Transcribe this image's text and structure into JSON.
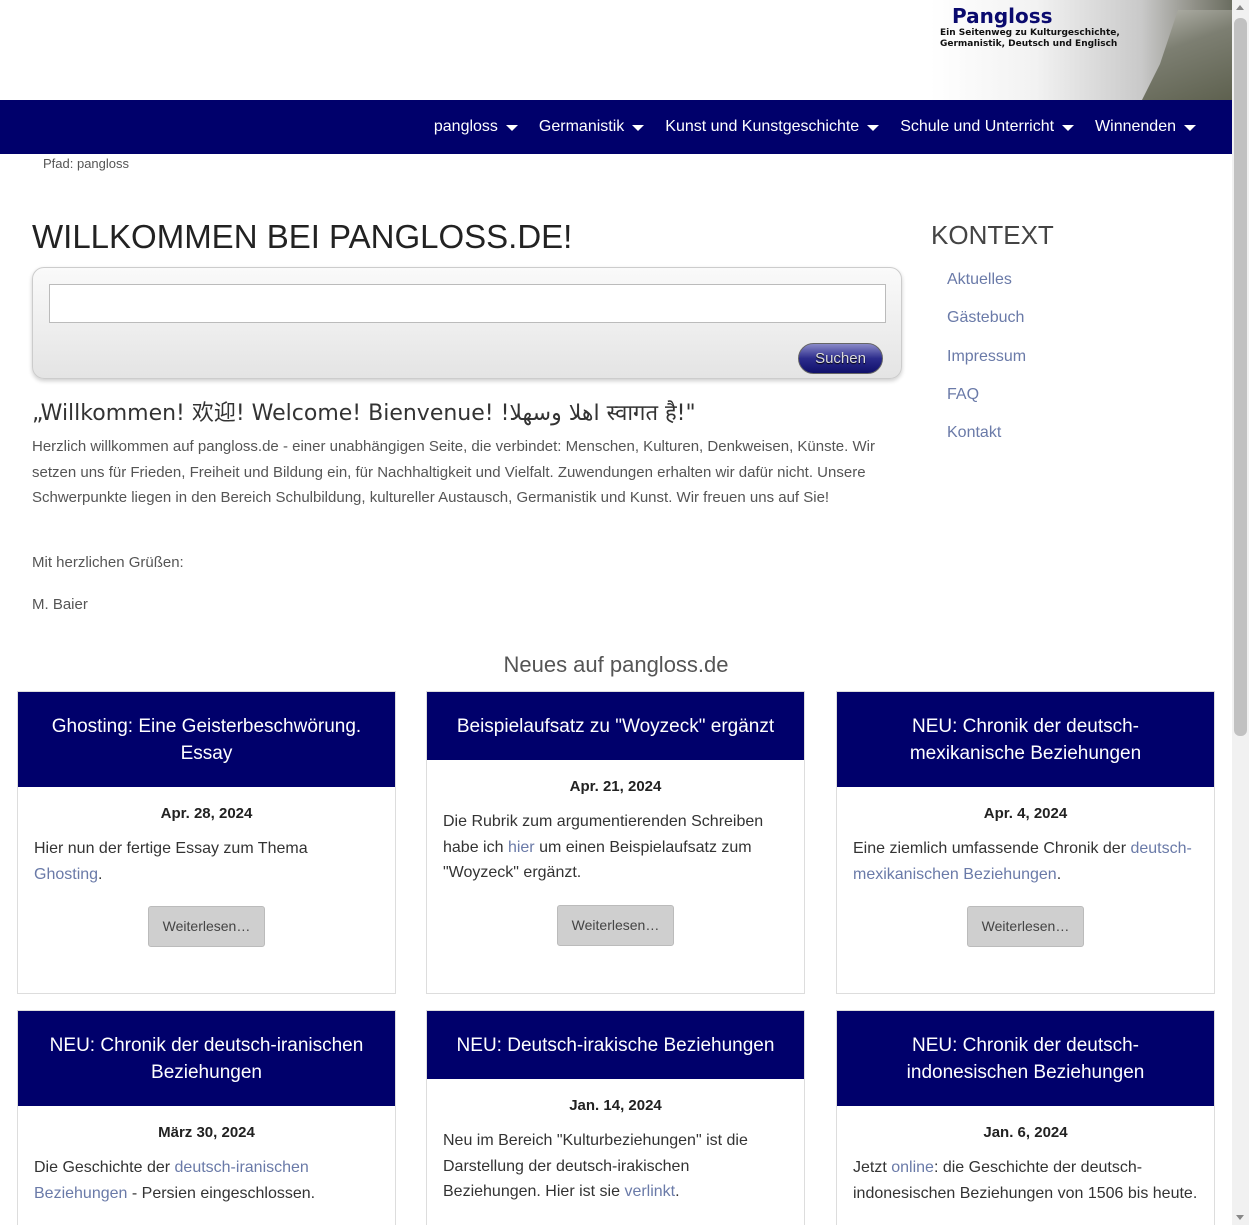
{
  "header": {
    "logo_title": "Pangloss",
    "logo_subtitle_line1": "Ein Seitenweg zu Kulturgeschichte,",
    "logo_subtitle_line2": "Germanistik, Deutsch und Englisch"
  },
  "nav": {
    "items": [
      {
        "label": "pangloss"
      },
      {
        "label": "Germanistik"
      },
      {
        "label": "Kunst und Kunstgeschichte"
      },
      {
        "label": "Schule und Unterricht"
      },
      {
        "label": "Winnenden"
      }
    ],
    "caret_icon": "caret-down-icon",
    "background": "#00006b"
  },
  "breadcrumb": "Pfad: pangloss",
  "main": {
    "title": "WILLKOMMEN BEI PANGLOSS.DE!",
    "search": {
      "value": "",
      "button_label": "Suchen"
    },
    "welcome_heading": "„Willkommen! 欢迎! Welcome! Bienvenue! !اهلا وسهلا स्वागत है!\"",
    "intro": "Herzlich willkommen auf pangloss.de - einer unabhängigen Seite, die verbindet: Menschen, Kulturen, Denkweisen, Künste. Wir setzen uns für Frieden, Freiheit und Bildung ein, für Nachhaltigkeit und Vielfalt.  Zuwendungen erhalten wir dafür nicht.  Unsere Schwerpunkte liegen in den Bereich Schulbildung, kultureller Austausch, Germanistik und Kunst. Wir freuen uns auf Sie!",
    "greeting": "Mit herzlichen Grüßen:",
    "signature": "M. Baier"
  },
  "sidebar": {
    "title": "KONTEXT",
    "links": [
      "Aktuelles",
      "Gästebuch",
      "Impressum",
      "FAQ",
      "Kontakt"
    ]
  },
  "news": {
    "title": "Neues auf pangloss.de",
    "cards": [
      {
        "title": "Ghosting: Eine Geisterbeschwörung. Essay",
        "date": "Apr. 28, 2024",
        "text_before": "Hier nun der fertige Essay zum Thema ",
        "link": "Ghosting",
        "text_after": ".",
        "button": "Weiterlesen…"
      },
      {
        "title": "Beispielaufsatz zu \"Woyzeck\" ergänzt",
        "date": "Apr. 21, 2024",
        "text_before": "Die Rubrik zum argumentierenden Schreiben habe ich ",
        "link": "hier",
        "text_after": " um einen Beispielaufsatz zum \"Woyzeck\" ergänzt.",
        "button": "Weiterlesen…"
      },
      {
        "title": "NEU: Chronik der deutsch-mexikanische Beziehungen",
        "date": "Apr. 4, 2024",
        "text_before": "Eine ziemlich umfassende Chronik der ",
        "link": "deutsch-mexikanischen Beziehungen",
        "text_after": ".",
        "button": "Weiterlesen…"
      },
      {
        "title": "NEU: Chronik der deutsch-iranischen Beziehungen",
        "date": "März 30, 2024",
        "text_before": "Die Geschichte der ",
        "link": "deutsch-iranischen Beziehungen",
        "text_after": " - Persien eingeschlossen."
      },
      {
        "title": "NEU: Deutsch-irakische Beziehungen",
        "date": "Jan. 14, 2024",
        "text_before": "Neu im Bereich \"Kulturbeziehungen\" ist die Darstellung der deutsch-irakischen Beziehungen. Hier ist sie ",
        "link": "verlinkt",
        "text_after": "."
      },
      {
        "title": "NEU: Chronik der deutsch-indonesischen Beziehungen",
        "date": "Jan. 6, 2024",
        "text_before": "Jetzt ",
        "link": "online",
        "text_after": ": die Geschichte der deutsch-indonesischen Beziehungen von 1506 bis heute."
      }
    ]
  }
}
